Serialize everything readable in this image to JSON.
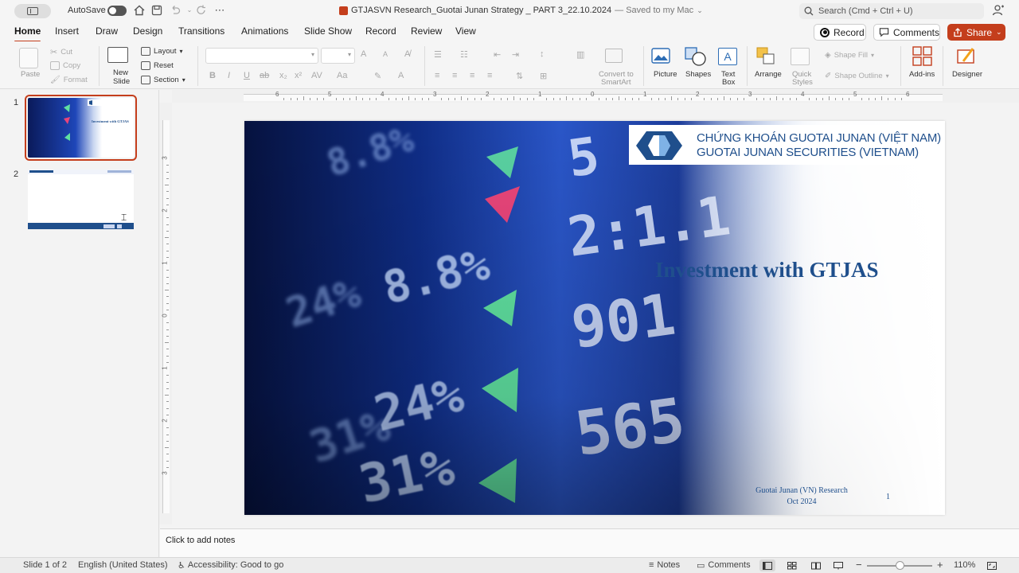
{
  "titlebar": {
    "autosave_label": "AutoSave",
    "document_title": "GTJASVN Research_Guotai Junan Strategy _ PART 3_22.10.2024",
    "save_status": "— Saved to my Mac",
    "search_placeholder": "Search (Cmd + Ctrl + U)"
  },
  "tabs": [
    {
      "label": "Home"
    },
    {
      "label": "Insert"
    },
    {
      "label": "Draw"
    },
    {
      "label": "Design"
    },
    {
      "label": "Transitions"
    },
    {
      "label": "Animations"
    },
    {
      "label": "Slide Show"
    },
    {
      "label": "Record"
    },
    {
      "label": "Review"
    },
    {
      "label": "View"
    }
  ],
  "top_actions": {
    "record": "Record",
    "comments": "Comments",
    "share": "Share"
  },
  "ribbon": {
    "paste": "Paste",
    "cut": "Cut",
    "copy": "Copy",
    "format": "Format",
    "new_slide_1": "New",
    "new_slide_2": "Slide",
    "layout": "Layout",
    "reset": "Reset",
    "section": "Section",
    "convert_1": "Convert to",
    "convert_2": "SmartArt",
    "picture": "Picture",
    "shapes": "Shapes",
    "textbox_1": "Text",
    "textbox_2": "Box",
    "arrange": "Arrange",
    "quick_styles_1": "Quick",
    "quick_styles_2": "Styles",
    "shape_fill": "Shape Fill",
    "shape_outline": "Shape Outline",
    "add_ins": "Add-ins",
    "designer": "Designer"
  },
  "ruler": {
    "h_numbers": [
      "6",
      "5",
      "4",
      "3",
      "2",
      "1",
      "0",
      "1",
      "2",
      "3",
      "4",
      "5",
      "6"
    ],
    "v_numbers": [
      "3",
      "2",
      "1",
      "0",
      "1",
      "2",
      "3"
    ]
  },
  "thumbnails": [
    {
      "number": "1"
    },
    {
      "number": "2"
    }
  ],
  "slide": {
    "logo_line_1": "CHỨNG KHOÁN GUOTAI JUNAN (VIỆT NAM)",
    "logo_line_2": "GUOTAI JUNAN SECURITIES (VIETNAM)",
    "title": "Investment with GTJAS",
    "footer_line_1": "Guotai Junan (VN) Research",
    "footer_line_2": "Oct 2024",
    "page_number": "1",
    "ticker_texts": [
      "5",
      "2:1.1",
      "901",
      "565",
      "8.8%",
      "24%",
      "31%"
    ],
    "thumb_title": "Investment with GTJAS"
  },
  "notes_placeholder": "Click to add notes",
  "statusbar": {
    "slide_count": "Slide 1 of 2",
    "language": "English (United States)",
    "accessibility": "Accessibility: Good to go",
    "notes": "Notes",
    "comments": "Comments",
    "zoom": "110%"
  },
  "colors": {
    "accent": "#c43e1c",
    "brand_blue": "#1f4f8c",
    "up_green": "#5fe0a0",
    "down_red": "#e8457a"
  }
}
